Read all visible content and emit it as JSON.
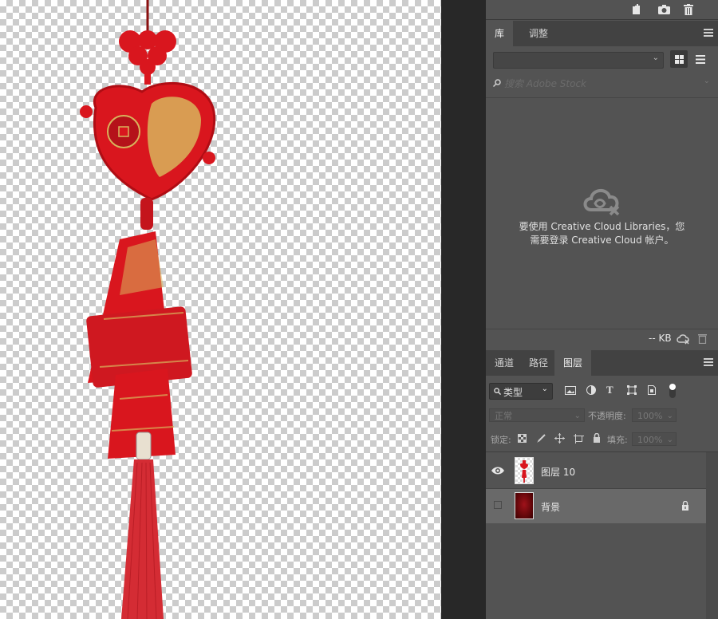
{
  "colors": {
    "ornament_red": "#d9161e",
    "gold": "#d8b45c",
    "panel_bg": "#535353",
    "tab_bg": "#424242",
    "gutter": "#282828"
  },
  "top_icons": [
    "new-document-icon",
    "camera-icon",
    "trash-icon"
  ],
  "library_tabs": [
    {
      "label": "库",
      "active": true
    },
    {
      "label": "调整",
      "active": false
    }
  ],
  "library": {
    "search_placeholder": "搜索 Adobe Stock",
    "message_line1": "要使用 Creative Cloud Libraries，您",
    "message_line2": "需要登录 Creative Cloud 帐户。",
    "size": "-- KB"
  },
  "layer_tabs": [
    {
      "label": "通道",
      "active": false
    },
    {
      "label": "路径",
      "active": false
    },
    {
      "label": "图层",
      "active": true
    }
  ],
  "layers_panel": {
    "filter_label": "类型",
    "blend_mode": "正常",
    "opacity_label": "不透明度:",
    "opacity_value": "100%",
    "lock_label": "锁定:",
    "fill_label": "填充:",
    "fill_value": "100%"
  },
  "layers": [
    {
      "name": "图层 10",
      "visible": true,
      "selected": false,
      "locked": false
    },
    {
      "name": "背景",
      "visible": false,
      "selected": true,
      "locked": true
    }
  ]
}
